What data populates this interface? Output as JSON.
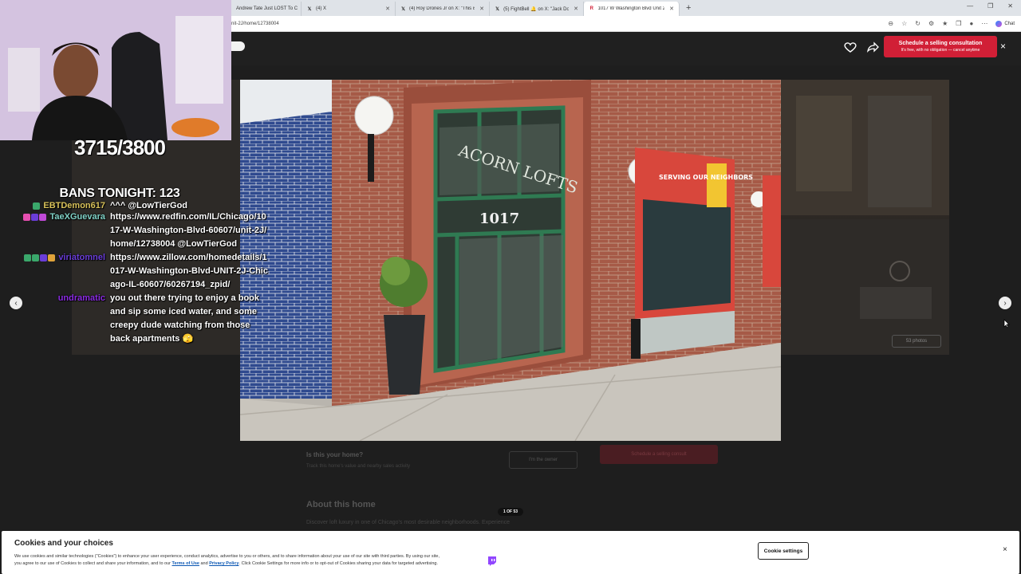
{
  "browser": {
    "tabs": [
      {
        "label": "Andrew Tate Just LOST To C",
        "icon": "youtube-icon",
        "active": false
      },
      {
        "label": "(4) X",
        "icon": "x-icon",
        "active": false
      },
      {
        "label": "(4) Roy Drones Jr on X: \"This is wh",
        "icon": "x-icon",
        "active": false
      },
      {
        "label": "(5) FightBell 🔔 on X: \"Jack Doher",
        "icon": "x-icon",
        "active": false
      },
      {
        "label": "1017 W Washington Blvd Unit 2J,",
        "icon": "redfin-icon",
        "active": true
      }
    ],
    "new_tab": "+",
    "url": "nit-2J/home/12738004",
    "chat_label": "Chat"
  },
  "modal": {
    "cta_title": "Schedule a selling consultation",
    "cta_sub": "It's free, with no obligation — cancel anytime",
    "close": "×",
    "photo_counter": "1 OF 53",
    "photos_chip": "53 photos",
    "sign": "ACORN LOFTS",
    "number": "1017",
    "window_text": "SERVING OUR NEIGHBORS"
  },
  "page_behind": {
    "question": "Is this your home?",
    "question_sub": "Track this home's value and nearby sales activity",
    "owner_button": "I'm the owner",
    "schedule_button": "Schedule a selling consult",
    "about_heading": "About this home",
    "about_text": "Discover loft luxury in one of Chicago's most desirable neighborhoods. Experience"
  },
  "cookie": {
    "title": "Cookies and your choices",
    "line1": "We use cookies and similar technologies (\"Cookies\") to enhance your user experience, conduct analytics, advertise to you or others, and to share information about your use of our site with third parties. By using our site,",
    "line2_pre": "you agree to our use of Cookies to collect and share your information, and to our",
    "terms": "Terms of Use",
    "and": "and",
    "privacy": "Privacy Policy",
    "line2_post": ". Click Cookie Settings for more info or to opt-out of Cookies sharing your data for targeted advertising.",
    "settings_button": "Cookie settings",
    "close": "×"
  },
  "stream": {
    "counter": "3715/3800",
    "bans": "BANS TONIGHT: 123",
    "chat": [
      {
        "user": "EBTDemon617",
        "color": "#d8c15a",
        "message": "^^^ @LowTierGod"
      },
      {
        "user": "TaeXGuevara",
        "color": "#7fd1c6",
        "message": "https://www.redfin.com/IL/Chicago/1017-W-Washington-Blvd-60607/unit-2J/home/12738004 @LowTierGod"
      },
      {
        "user": "viriatomnel",
        "color": "#6a3dd8",
        "message": "https://www.zillow.com/homedetails/1017-W-Washington-Blvd-UNIT-2J-Chicago-IL-60607/60267194_zpid/"
      },
      {
        "user": "undramatic",
        "color": "#8a2be2",
        "message": "you out there trying to enjoy a book and sip some iced water, and some creepy dude watching from those back apartments 🫣"
      }
    ]
  },
  "colors": {
    "accent": "#d11f36",
    "page_bg": "#1e1e1e",
    "link": "#0b57b3"
  }
}
